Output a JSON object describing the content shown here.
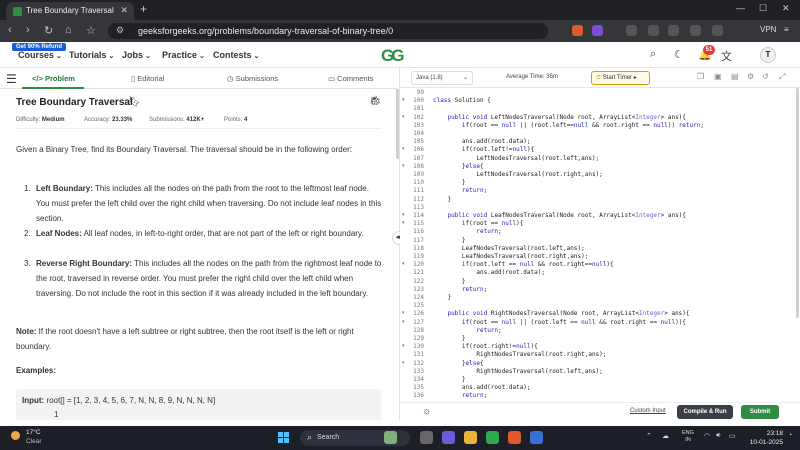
{
  "browser": {
    "tab_title": "Tree Boundary Traversal | Practic",
    "url": "geeksforgeeks.org/problems/boundary-traversal-of-binary-tree/0",
    "vpn_label": "VPN"
  },
  "header": {
    "promo": "Get 90% Refund",
    "menu": [
      "Courses",
      "Tutorials",
      "Jobs",
      "Practice",
      "Contests"
    ],
    "logo": "GG",
    "notification_count": "51",
    "avatar_initial": "T"
  },
  "left_tabs": [
    "Problem",
    "Editorial",
    "Submissions",
    "Comments"
  ],
  "problem": {
    "title": "Tree Boundary Traversal",
    "difficulty_label": "Difficulty:",
    "difficulty": "Medium",
    "accuracy_label": "Accuracy:",
    "accuracy": "23.33%",
    "submissions_label": "Submissions:",
    "submissions": "412K+",
    "points_label": "Points:",
    "points": "4",
    "intro": "Given a Binary Tree, find its Boundary Traversal. The traversal should be in the following order:",
    "list": [
      {
        "num": "1.",
        "head": "Left Boundary:",
        "text": " This includes all the nodes on the path from the root to the leftmost leaf node. You must prefer the left child over the right child when traversing. Do not include leaf nodes in this section."
      },
      {
        "num": "2.",
        "head": "Leaf Nodes:",
        "text": " All leaf nodes, in left-to-right order, that are not part of the left or right boundary."
      },
      {
        "num": "3.",
        "head": "Reverse Right Boundary:",
        "text": " This includes all the nodes on the path from the rightmost leaf node to the root, traversed in reverse order. You must prefer the right child over the left child when traversing. Do not include the root in this section if it was already included in the left boundary."
      }
    ],
    "note_head": "Note:",
    "note_text": " If the root doesn't have a left subtree or right subtree, then the root itself is the left or right boundary.",
    "examples_head": "Examples:",
    "example_input_label": "Input:",
    "example_input": " root[] = [1, 2, 3, 4, 5, 6, 7, N, N, 8, 9, N, N, N, N]",
    "example_tree_top": "1"
  },
  "editor": {
    "language": "Java (1.8)",
    "avg_time": "Average Time: 35m",
    "timer": "Start Timer",
    "custom_input": "Custom Input",
    "compile": "Compile & Run",
    "submit": "Submit",
    "lines": [
      {
        "n": "99",
        "f": "",
        "c": ""
      },
      {
        "n": "100",
        "f": "▾",
        "c": "class Solution {"
      },
      {
        "n": "101",
        "f": "",
        "c": ""
      },
      {
        "n": "102",
        "f": "▾",
        "c": "    public void LeftNodesTraversal(Node root, ArrayList<Integer> ans){"
      },
      {
        "n": "103",
        "f": "",
        "c": "        if(root == null || (root.left==null && root.right == null)) return;"
      },
      {
        "n": "104",
        "f": "",
        "c": ""
      },
      {
        "n": "105",
        "f": "",
        "c": "        ans.add(root.data);"
      },
      {
        "n": "106",
        "f": "▾",
        "c": "        if(root.left!=null){"
      },
      {
        "n": "107",
        "f": "",
        "c": "            LeftNodesTraversal(root.left,ans);"
      },
      {
        "n": "108",
        "f": "▾",
        "c": "        }else{"
      },
      {
        "n": "109",
        "f": "",
        "c": "            LeftNodesTraversal(root.right,ans);"
      },
      {
        "n": "110",
        "f": "",
        "c": "        }"
      },
      {
        "n": "111",
        "f": "",
        "c": "        return;"
      },
      {
        "n": "112",
        "f": "",
        "c": "    }"
      },
      {
        "n": "113",
        "f": "",
        "c": ""
      },
      {
        "n": "114",
        "f": "▾",
        "c": "    public void LeafNodesTraversal(Node root, ArrayList<Integer> ans){"
      },
      {
        "n": "115",
        "f": "▾",
        "c": "        if(root == null){"
      },
      {
        "n": "116",
        "f": "",
        "c": "            return;"
      },
      {
        "n": "117",
        "f": "",
        "c": "        }"
      },
      {
        "n": "118",
        "f": "",
        "c": "        LeafNodesTraversal(root.left,ans);"
      },
      {
        "n": "119",
        "f": "",
        "c": "        LeafNodesTraversal(root.right,ans);"
      },
      {
        "n": "120",
        "f": "▾",
        "c": "        if(root.left == null && root.right==null){"
      },
      {
        "n": "121",
        "f": "",
        "c": "            ans.add(root.data);"
      },
      {
        "n": "122",
        "f": "",
        "c": "        }"
      },
      {
        "n": "123",
        "f": "",
        "c": "        return;"
      },
      {
        "n": "124",
        "f": "",
        "c": "    }"
      },
      {
        "n": "125",
        "f": "",
        "c": ""
      },
      {
        "n": "126",
        "f": "▾",
        "c": "    public void RightNodesTraversal(Node root, ArrayList<Integer> ans){"
      },
      {
        "n": "127",
        "f": "▾",
        "c": "        if(root == null || (root.left == null && root.right == null)){"
      },
      {
        "n": "128",
        "f": "",
        "c": "            return;"
      },
      {
        "n": "129",
        "f": "",
        "c": "        }"
      },
      {
        "n": "130",
        "f": "▾",
        "c": "        if(root.right!=null){"
      },
      {
        "n": "131",
        "f": "",
        "c": "            RightNodesTraversal(root.right,ans);"
      },
      {
        "n": "132",
        "f": "▾",
        "c": "        }else{"
      },
      {
        "n": "133",
        "f": "",
        "c": "            RightNodesTraversal(root.left,ans);"
      },
      {
        "n": "134",
        "f": "",
        "c": "        }"
      },
      {
        "n": "135",
        "f": "",
        "c": "        ans.add(root.data);"
      },
      {
        "n": "136",
        "f": "",
        "c": "        return;"
      }
    ]
  },
  "taskbar": {
    "weather_temp": "17°C",
    "weather_desc": "Clear",
    "search": "Search",
    "lang_top": "ENG",
    "lang_bottom": "IN",
    "time": "23:18",
    "date": "10-01-2025"
  },
  "colors": {
    "brand_green": "#2f8d46",
    "keyword_blue": "#1f1fb4",
    "type_purple": "#7a5cc7"
  }
}
